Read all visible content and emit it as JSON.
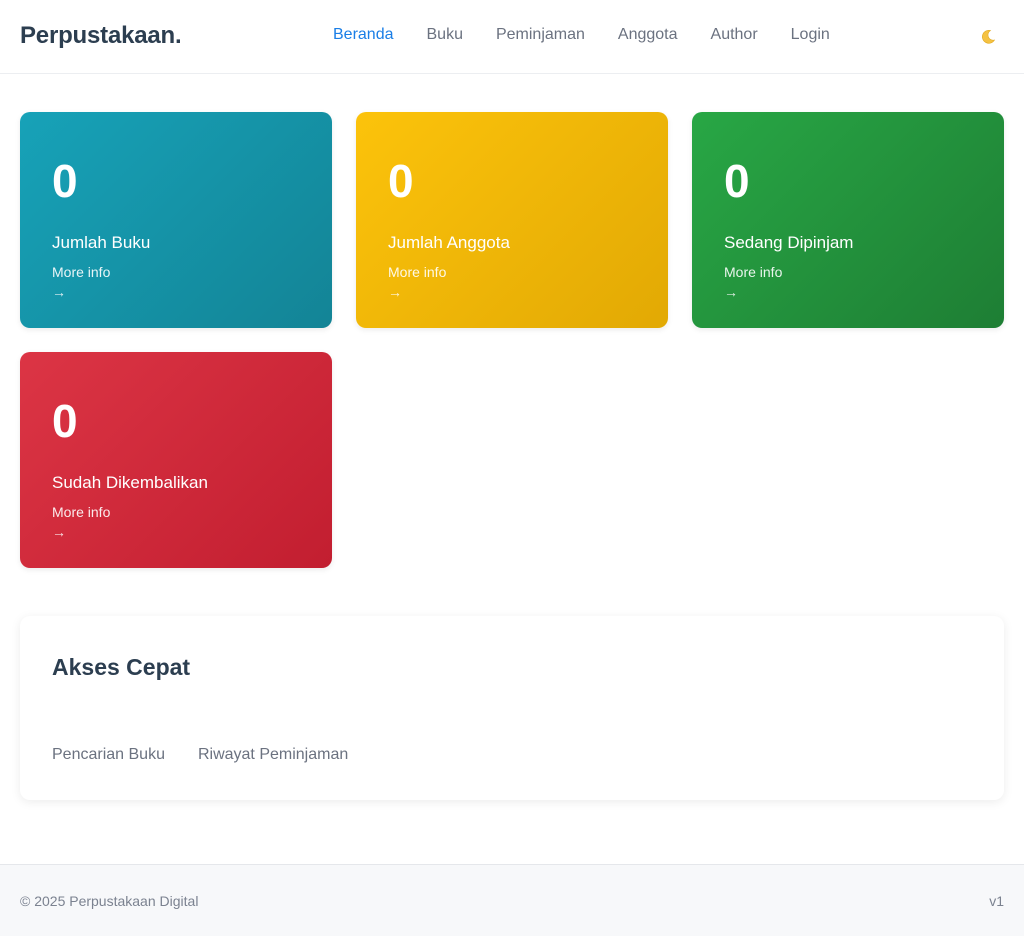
{
  "brand": "Perpustakaan.",
  "nav": {
    "items": [
      {
        "label": "Beranda",
        "active": true
      },
      {
        "label": "Buku",
        "active": false
      },
      {
        "label": "Peminjaman",
        "active": false
      },
      {
        "label": "Anggota",
        "active": false
      },
      {
        "label": "Author",
        "active": false
      },
      {
        "label": "Login",
        "active": false
      }
    ],
    "theme_icon": "moon-icon"
  },
  "stats": [
    {
      "value": "0",
      "label": "Jumlah Buku",
      "more": "More info",
      "arrow": "→",
      "color": "#17a2b8"
    },
    {
      "value": "0",
      "label": "Jumlah Anggota",
      "more": "More info",
      "arrow": "→",
      "color": "#fcc30b"
    },
    {
      "value": "0",
      "label": "Sedang Dipinjam",
      "more": "More info",
      "arrow": "→",
      "color": "#28a745"
    },
    {
      "value": "0",
      "label": "Sudah Dikembalikan",
      "more": "More info",
      "arrow": "→",
      "color": "#dc3545"
    }
  ],
  "quick_access": {
    "title": "Akses Cepat",
    "links": [
      "Pencarian Buku",
      "Riwayat Peminjaman"
    ]
  },
  "footer": {
    "copyright": "© 2025 Perpustakaan Digital",
    "version": "v1"
  },
  "colors": {
    "accent": "#1a7ee6",
    "text": "#2c3e50",
    "muted": "#6b7280"
  }
}
